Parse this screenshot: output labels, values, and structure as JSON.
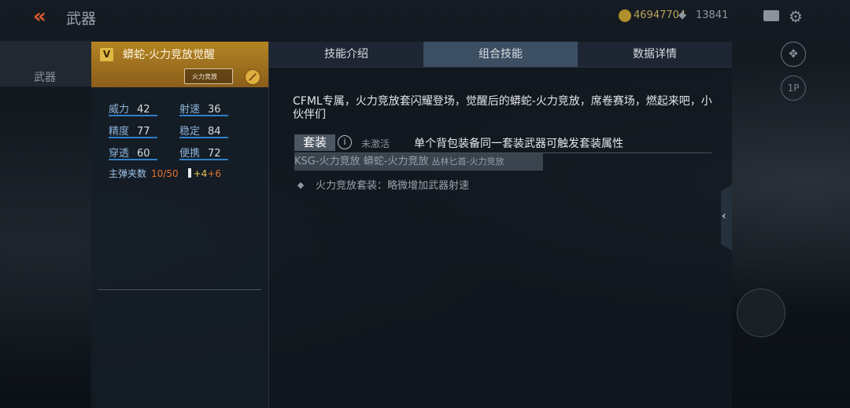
{
  "topbar": {
    "title": "武器",
    "currency1": "46947704",
    "currency2": "13841",
    "icons": [
      "back-arrow-icon",
      "coin-icon",
      "diamond-currency-icon",
      "mail-icon",
      "gear-icon"
    ]
  },
  "side": {
    "tab_label": "武器",
    "btn_1p": "1P"
  },
  "weapon": {
    "name": "蟒蛇-火力竞放觉醒",
    "badge": "V",
    "skin_label": "火力竞放",
    "stats": [
      {
        "label": "威力",
        "value": "42"
      },
      {
        "label": "射速",
        "value": "36"
      },
      {
        "label": "精度",
        "value": "77"
      },
      {
        "label": "稳定",
        "value": "84"
      },
      {
        "label": "穿透",
        "value": "60"
      },
      {
        "label": "便携",
        "value": "72"
      }
    ],
    "ammo_label": "主弹夹数",
    "ammo_value": "10/50",
    "ammo_bonus_a": "+4",
    "ammo_bonus_b": "+6"
  },
  "tabs": [
    {
      "label": "技能介绍",
      "active": false
    },
    {
      "label": "组合技能",
      "active": true
    },
    {
      "label": "数据详情",
      "active": false
    }
  ],
  "content": {
    "description": "CFML专属，火力竞放套闪耀登场，觉醒后的蟒蛇-火力竞放，席卷赛场，燃起来吧，小伙伴们",
    "set_tag": "套装",
    "set_status": "未激活",
    "set_desc": "单个背包装备同一套装武器可触发套装属性",
    "set_weapon_1": "KSG-火力竞放",
    "set_weapon_2": "蟒蛇-火力竞放",
    "set_weapon_3": "丛林匕首-火力竞放",
    "bonus": "火力竞放套装：略微增加武器射速"
  },
  "colors": {
    "accent_gold": "#b48423",
    "tab_active": "#3c4e62",
    "stat_underline": "#2f80c8",
    "ammo_orange": "#e3722d"
  }
}
